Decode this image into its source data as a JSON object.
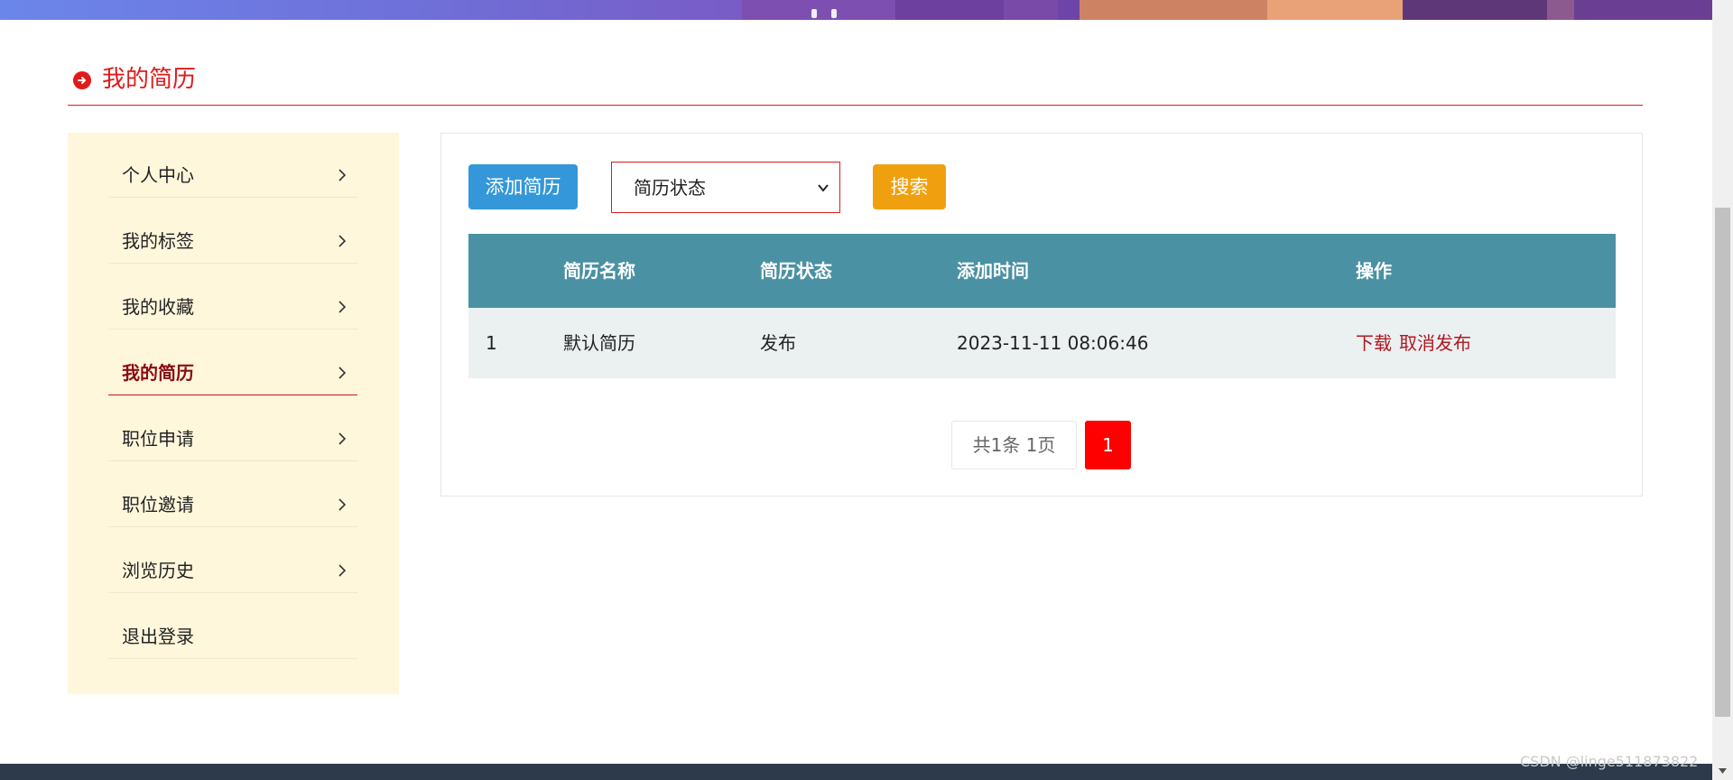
{
  "section": {
    "title": "我的简历",
    "title_icon": "arrow-circle-right-icon",
    "accent_color": "#e01b1b"
  },
  "sidebar": {
    "items": [
      {
        "label": "个人中心",
        "icon": "chevron-right-icon",
        "active": false
      },
      {
        "label": "我的标签",
        "icon": "chevron-right-icon",
        "active": false
      },
      {
        "label": "我的收藏",
        "icon": "chevron-right-icon",
        "active": false
      },
      {
        "label": "我的简历",
        "icon": "chevron-right-icon",
        "active": true
      },
      {
        "label": "职位申请",
        "icon": "chevron-right-icon",
        "active": false
      },
      {
        "label": "职位邀请",
        "icon": "chevron-right-icon",
        "active": false
      },
      {
        "label": "浏览历史",
        "icon": "chevron-right-icon",
        "active": false
      },
      {
        "label": "退出登录",
        "icon": "",
        "active": false
      }
    ]
  },
  "toolbar": {
    "add_label": "添加简历",
    "status_select": {
      "selected": "简历状态"
    },
    "search_label": "搜索"
  },
  "table": {
    "headers": [
      "",
      "简历名称",
      "简历状态",
      "添加时间",
      "操作"
    ],
    "rows": [
      {
        "index": "1",
        "name": "默认简历",
        "status": "发布",
        "time": "2023-11-11 08:06:46",
        "actions": [
          "下载",
          "取消发布"
        ]
      }
    ]
  },
  "pagination": {
    "info": "共1条  1页",
    "current": "1"
  },
  "watermark": "CSDN @linge511873822",
  "colors": {
    "add_button": "#3497d9",
    "search_button": "#f0a00f",
    "table_header": "#4a91a3",
    "row_bg": "#ebf0f1",
    "sidebar_bg": "#fff7dc",
    "page_active": "#ff0000"
  }
}
